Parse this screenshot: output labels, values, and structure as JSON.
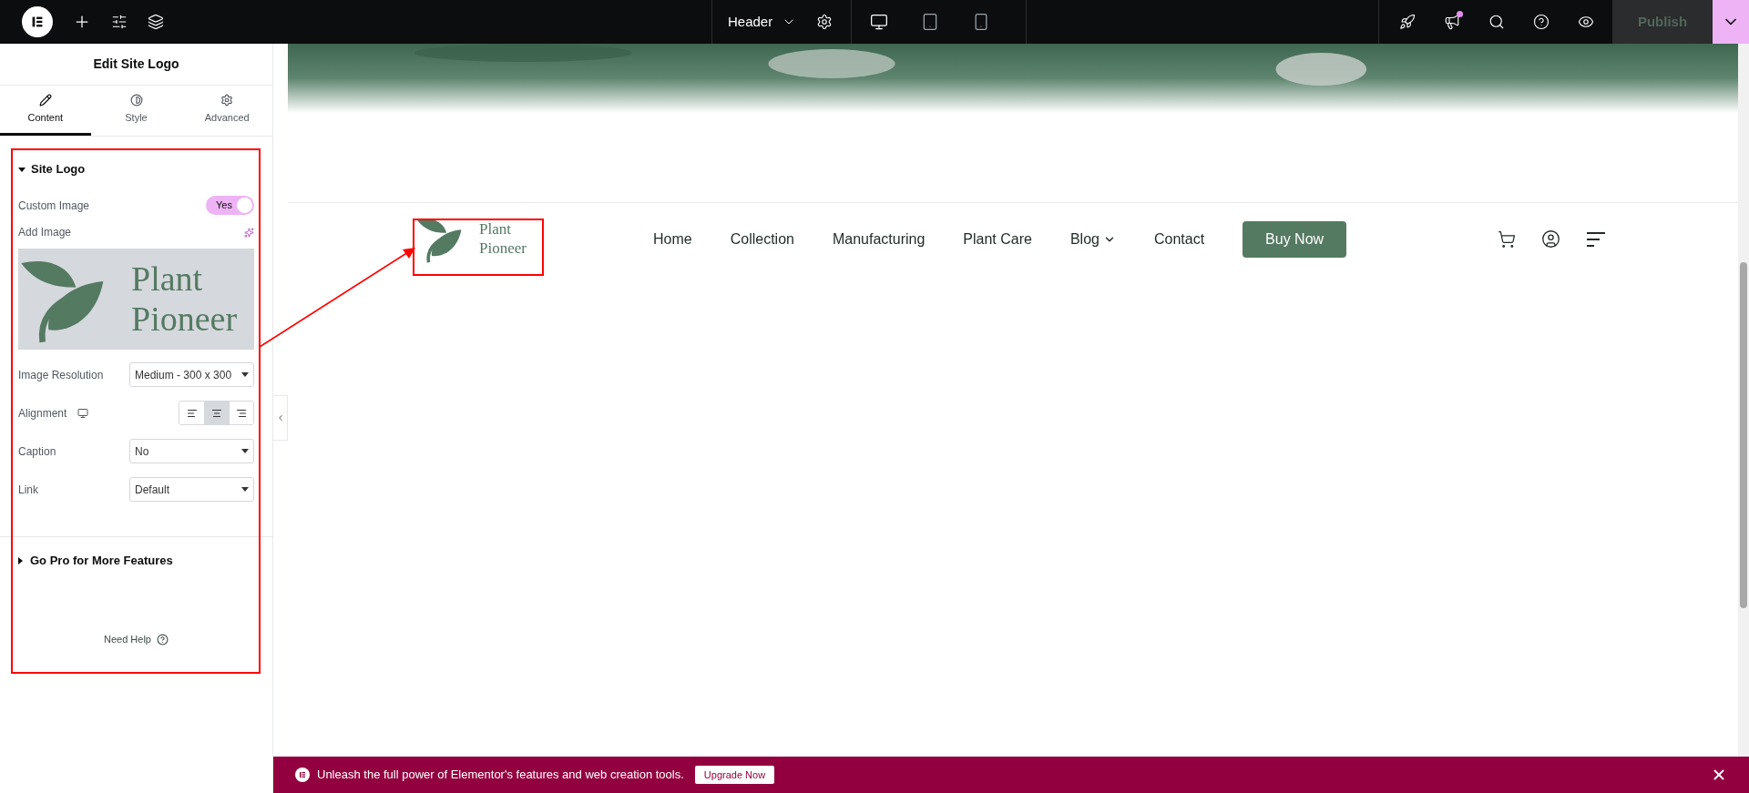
{
  "topbar": {
    "document": "Header",
    "devices": [
      {
        "kind": "desktop",
        "selected": true
      },
      {
        "kind": "tablet",
        "selected": false
      },
      {
        "kind": "mobile",
        "selected": false
      }
    ],
    "publish": "Publish",
    "has_notification": true
  },
  "panel": {
    "title": "Edit Site Logo",
    "tabs": [
      {
        "label": "Content",
        "kind": "pencil",
        "selected": true
      },
      {
        "label": "Style",
        "kind": "contrast",
        "selected": false
      },
      {
        "label": "Advanced",
        "kind": "gear",
        "selected": false
      }
    ],
    "site_logo": {
      "title": "Site Logo",
      "expanded": true,
      "custom_image": {
        "label": "Custom Image",
        "on": true,
        "on_text": "Yes"
      },
      "add_image": {
        "label": "Add Image",
        "logo_lines": [
          "Plant",
          "Pioneer"
        ]
      },
      "resolution": {
        "label": "Image Resolution",
        "value": "Medium - 300 x 300"
      },
      "alignment": {
        "label": "Alignment",
        "options": [
          {
            "kind": "left",
            "selected": false
          },
          {
            "kind": "center",
            "selected": true
          },
          {
            "kind": "right",
            "selected": false
          }
        ]
      },
      "caption": {
        "label": "Caption",
        "value": "No"
      },
      "link": {
        "label": "Link",
        "value": "Default"
      }
    },
    "pro": {
      "title": "Go Pro for More Features",
      "expanded": false
    },
    "help": "Need Help"
  },
  "site": {
    "logo_lines": [
      "Plant",
      "Pioneer"
    ],
    "nav": [
      {
        "label": "Home",
        "has_menu": false
      },
      {
        "label": "Collection",
        "has_menu": false
      },
      {
        "label": "Manufacturing",
        "has_menu": false
      },
      {
        "label": "Plant Care",
        "has_menu": false
      },
      {
        "label": "Blog",
        "has_menu": true
      },
      {
        "label": "Contact",
        "has_menu": false
      }
    ],
    "cta": "Buy Now"
  },
  "banner": {
    "text": "Unleash the full power of Elementor's features and web creation tools.",
    "button": "Upgrade Now"
  }
}
